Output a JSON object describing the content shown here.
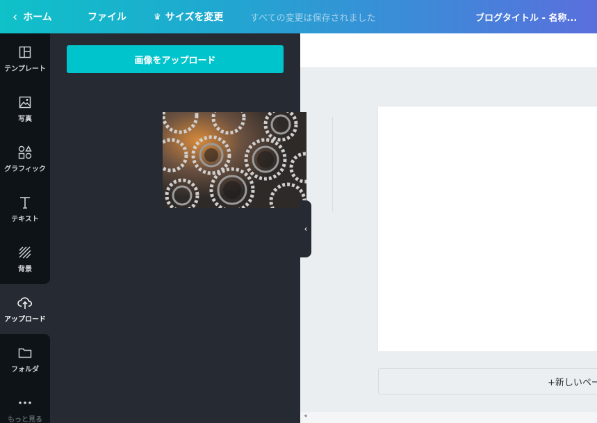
{
  "topbar": {
    "home_label": "ホーム",
    "file_label": "ファイル",
    "resize_label": "サイズを変更",
    "saved_status": "すべての変更は保存されました",
    "doc_title": "ブログタイトル - 名称..."
  },
  "rail": {
    "items": [
      {
        "label": "テンプレート",
        "icon": "template-icon"
      },
      {
        "label": "写真",
        "icon": "photo-icon"
      },
      {
        "label": "グラフィック",
        "icon": "shapes-icon"
      },
      {
        "label": "テキスト",
        "icon": "text-icon"
      },
      {
        "label": "背景",
        "icon": "background-icon"
      },
      {
        "label": "アップロード",
        "icon": "cloud-upload-icon"
      },
      {
        "label": "フォルダ",
        "icon": "folder-icon"
      },
      {
        "label": "もっと見る",
        "icon": "more-icon"
      }
    ]
  },
  "panel": {
    "upload_button": "画像をアップロード"
  },
  "canvas": {
    "new_page_label": "+新しいペー"
  },
  "colors": {
    "accent": "#00c4cc",
    "rail_bg": "#0e1318",
    "panel_bg": "#252a33",
    "canvas_bg": "#ebeef1"
  }
}
